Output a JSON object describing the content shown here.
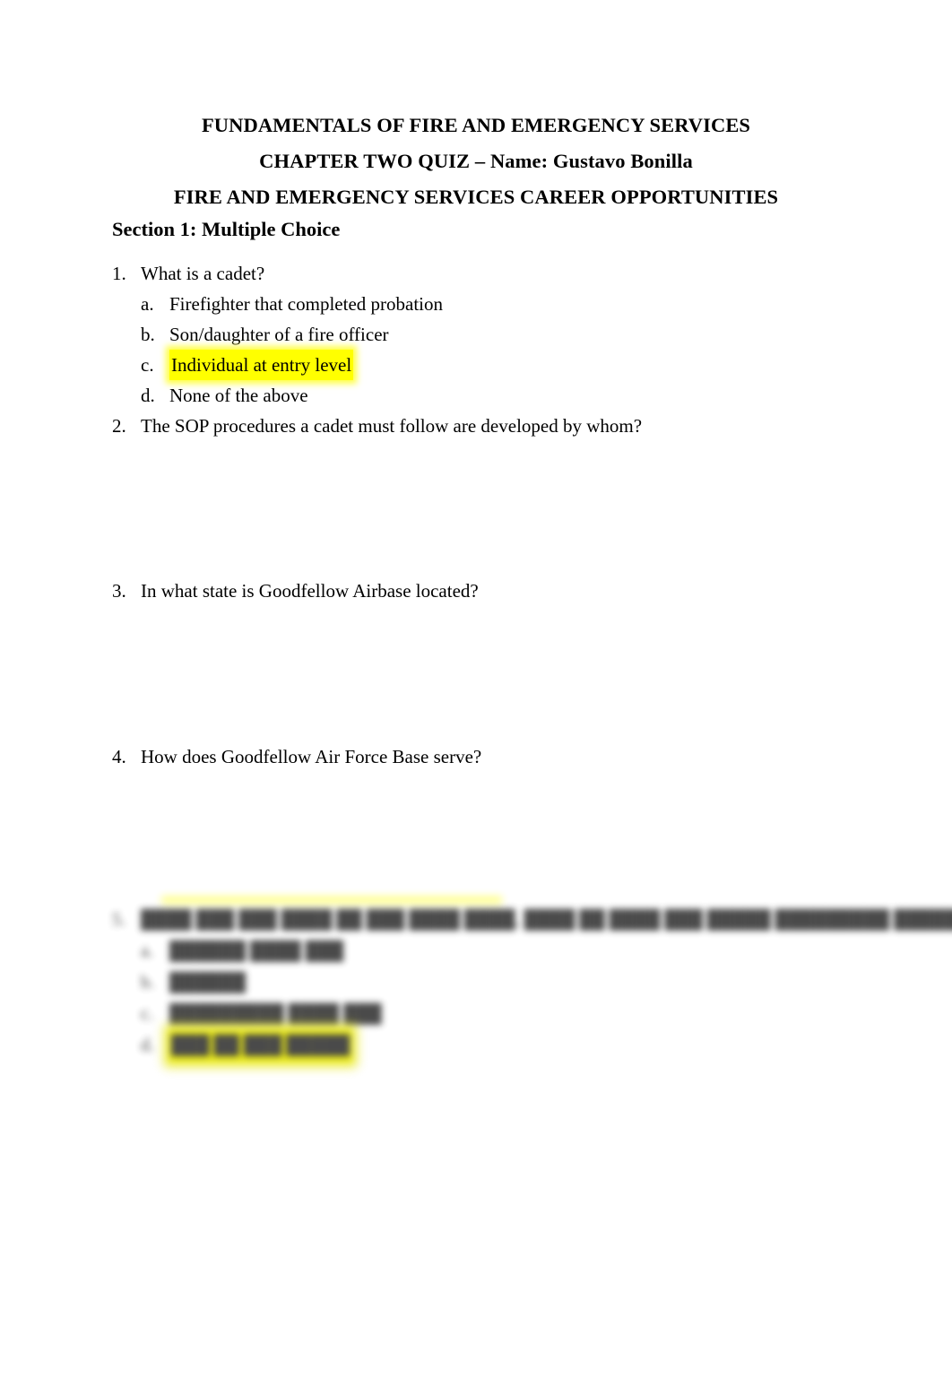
{
  "document": {
    "titles": [
      "FUNDAMENTALS OF FIRE AND EMERGENCY SERVICES",
      "CHAPTER TWO QUIZ – Name: Gustavo Bonilla",
      "FIRE AND EMERGENCY SERVICES CAREER OPPORTUNITIES"
    ],
    "section_heading": "Section 1: Multiple Choice",
    "highlight_color": "#FFFF00",
    "questions": [
      {
        "number": "1.",
        "text": "What is a cadet?",
        "options": [
          {
            "letter": "a.",
            "text": "Firefighter that completed probation",
            "highlighted": false
          },
          {
            "letter": "b.",
            "text": "Son/daughter of a fire officer",
            "highlighted": false
          },
          {
            "letter": "c.",
            "text": "Individual at entry level",
            "highlighted": true
          },
          {
            "letter": "d.",
            "text": "None of the above",
            "highlighted": false
          }
        ]
      },
      {
        "number": "2.",
        "text": "The SOP procedures a cadet must follow are developed by whom?",
        "options": []
      },
      {
        "number": "3.",
        "text": "In what state is Goodfellow Airbase located?",
        "options": []
      },
      {
        "number": "4.",
        "text": "How does Goodfellow Air Force Base serve?",
        "options": []
      }
    ],
    "obscured_question": {
      "number": "5.",
      "text": "████ ███ ███ ████ ██ ███ ████ ████, ████ ██ ████ ███ █████ █████████ ██████?",
      "options": [
        {
          "letter": "a.",
          "text": "██████ ████ ███",
          "highlighted": false
        },
        {
          "letter": "b.",
          "text": "██████",
          "highlighted": false
        },
        {
          "letter": "c.",
          "text": "█████████ ████ ███",
          "highlighted": false
        },
        {
          "letter": "d.",
          "text": "███ ██ ███ █████",
          "highlighted": true
        }
      ]
    }
  }
}
